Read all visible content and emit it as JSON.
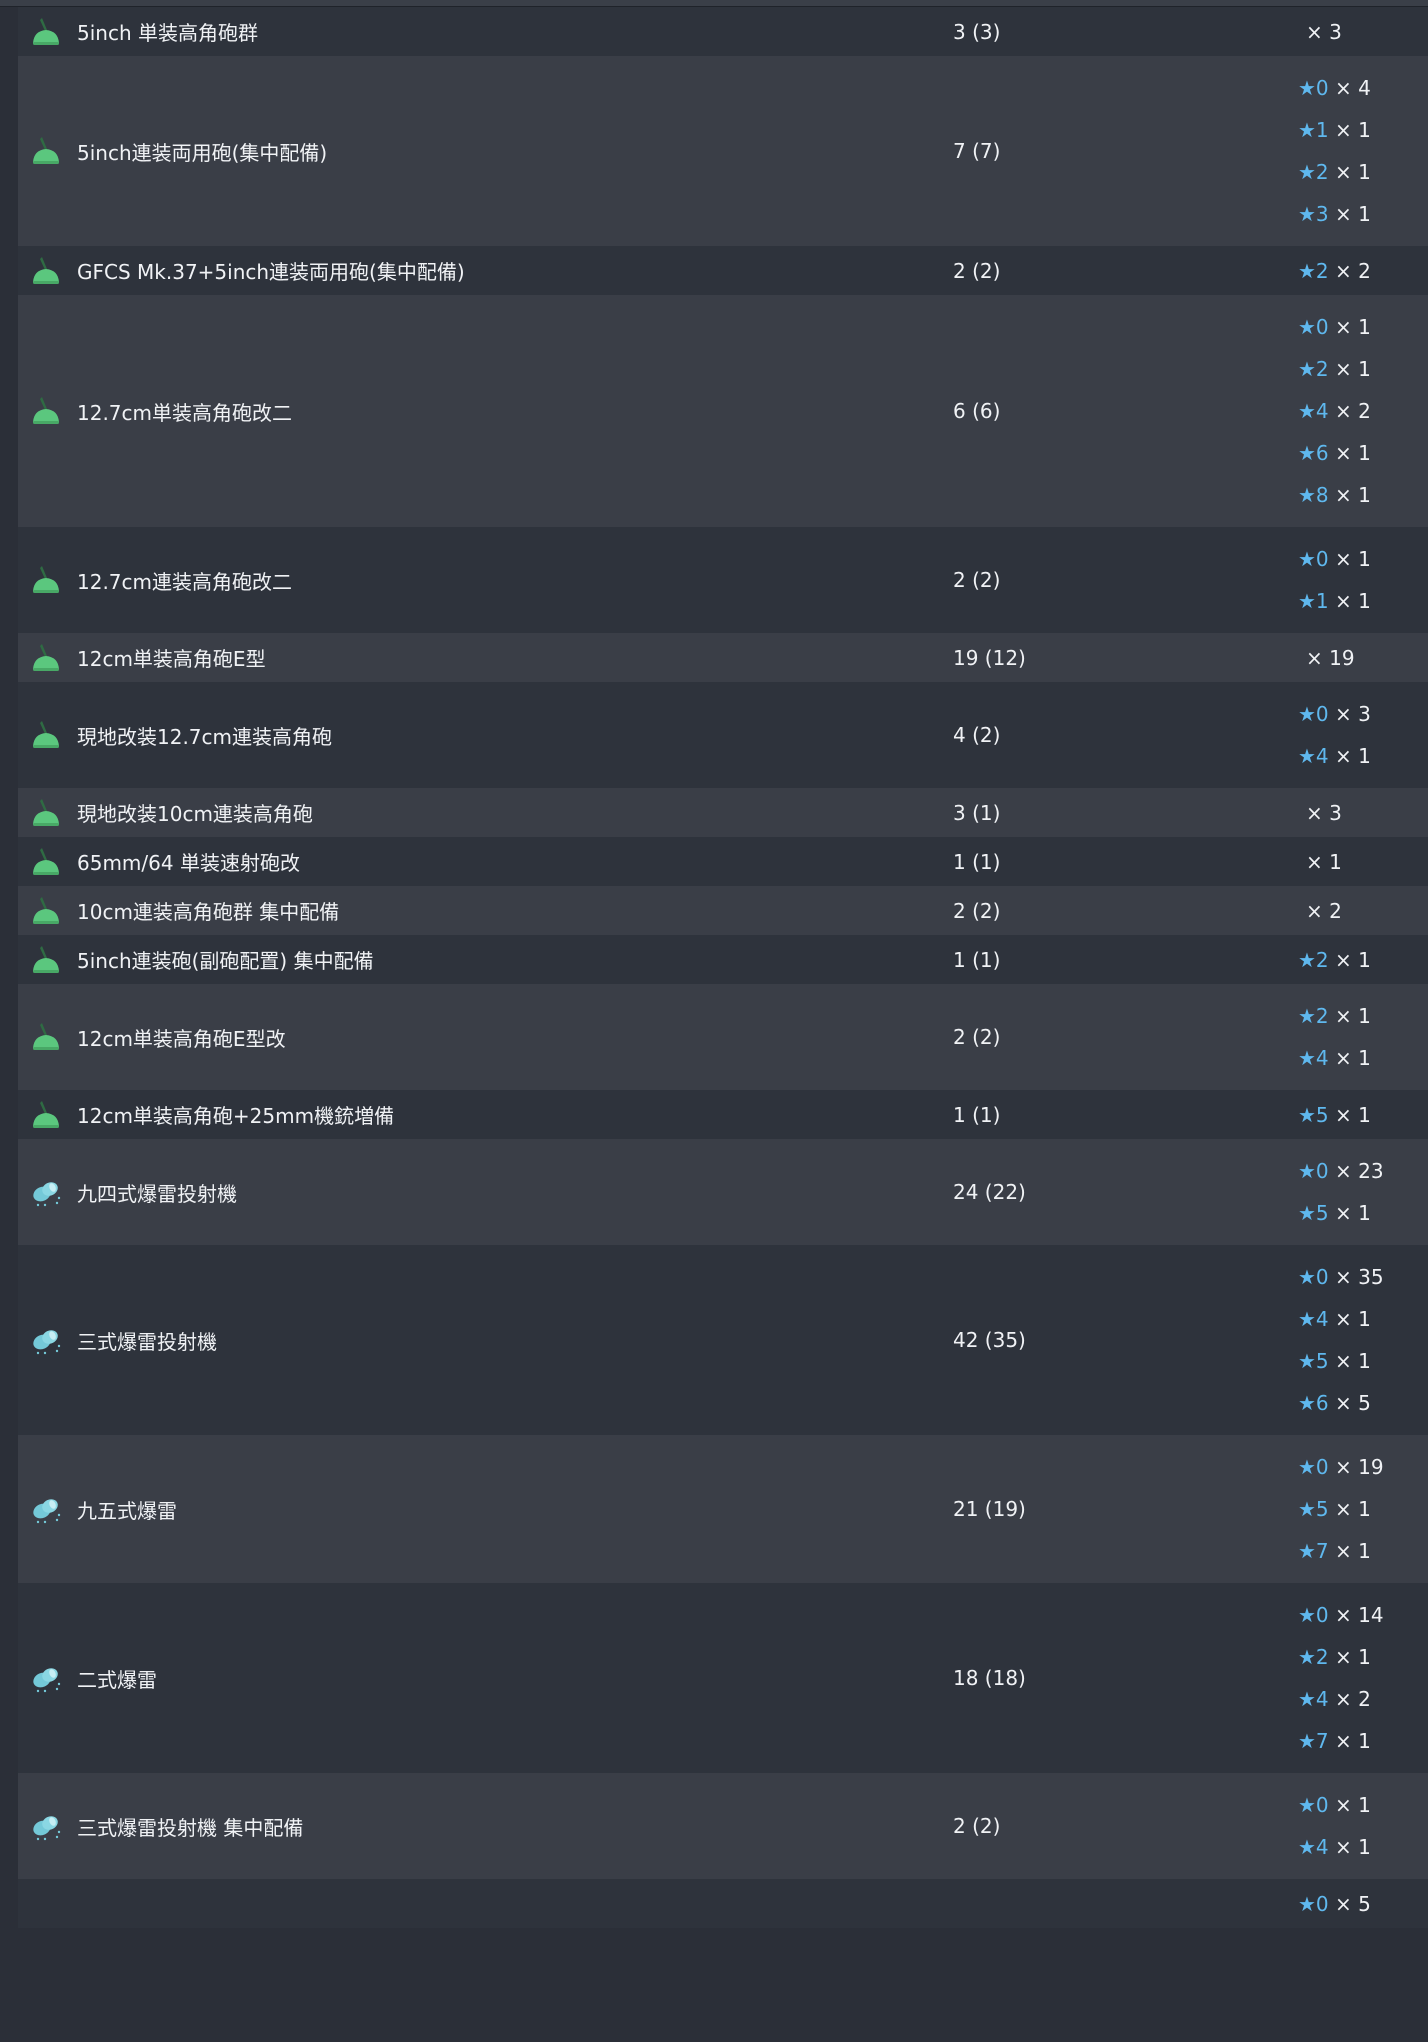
{
  "rows": [
    {
      "icon": "high-angle-gun-icon",
      "name": "5inch 単装高角砲群",
      "count": "3 (3)",
      "stars": [
        {
          "star": null,
          "qty": "× 3"
        }
      ]
    },
    {
      "icon": "high-angle-gun-icon",
      "name": "5inch連装両用砲(集中配備)",
      "count": "7 (7)",
      "stars": [
        {
          "star": "★0",
          "qty": "× 4"
        },
        {
          "star": "★1",
          "qty": "× 1"
        },
        {
          "star": "★2",
          "qty": "× 1"
        },
        {
          "star": "★3",
          "qty": "× 1"
        }
      ]
    },
    {
      "icon": "high-angle-gun-icon",
      "name": "GFCS Mk.37+5inch連装両用砲(集中配備)",
      "count": "2 (2)",
      "stars": [
        {
          "star": "★2",
          "qty": "× 2"
        }
      ]
    },
    {
      "icon": "high-angle-gun-icon",
      "name": "12.7cm単装高角砲改二",
      "count": "6 (6)",
      "stars": [
        {
          "star": "★0",
          "qty": "× 1"
        },
        {
          "star": "★2",
          "qty": "× 1"
        },
        {
          "star": "★4",
          "qty": "× 2"
        },
        {
          "star": "★6",
          "qty": "× 1"
        },
        {
          "star": "★8",
          "qty": "× 1"
        }
      ]
    },
    {
      "icon": "high-angle-gun-icon",
      "name": "12.7cm連装高角砲改二",
      "count": "2 (2)",
      "stars": [
        {
          "star": "★0",
          "qty": "× 1"
        },
        {
          "star": "★1",
          "qty": "× 1"
        }
      ]
    },
    {
      "icon": "high-angle-gun-icon",
      "name": "12cm単装高角砲E型",
      "count": "19 (12)",
      "stars": [
        {
          "star": null,
          "qty": "× 19"
        }
      ]
    },
    {
      "icon": "high-angle-gun-icon",
      "name": "現地改装12.7cm連装高角砲",
      "count": "4 (2)",
      "stars": [
        {
          "star": "★0",
          "qty": "× 3"
        },
        {
          "star": "★4",
          "qty": "× 1"
        }
      ]
    },
    {
      "icon": "high-angle-gun-icon",
      "name": "現地改装10cm連装高角砲",
      "count": "3 (1)",
      "stars": [
        {
          "star": null,
          "qty": "× 3"
        }
      ]
    },
    {
      "icon": "high-angle-gun-icon",
      "name": "65mm/64 単装速射砲改",
      "count": "1 (1)",
      "stars": [
        {
          "star": null,
          "qty": "× 1"
        }
      ]
    },
    {
      "icon": "high-angle-gun-icon",
      "name": "10cm連装高角砲群 集中配備",
      "count": "2 (2)",
      "stars": [
        {
          "star": null,
          "qty": "× 2"
        }
      ]
    },
    {
      "icon": "high-angle-gun-icon",
      "name": "5inch連装砲(副砲配置) 集中配備",
      "count": "1 (1)",
      "stars": [
        {
          "star": "★2",
          "qty": "× 1"
        }
      ]
    },
    {
      "icon": "high-angle-gun-icon",
      "name": "12cm単装高角砲E型改",
      "count": "2 (2)",
      "stars": [
        {
          "star": "★2",
          "qty": "× 1"
        },
        {
          "star": "★4",
          "qty": "× 1"
        }
      ]
    },
    {
      "icon": "high-angle-gun-icon",
      "name": "12cm単装高角砲+25mm機銃増備",
      "count": "1 (1)",
      "stars": [
        {
          "star": "★5",
          "qty": "× 1"
        }
      ]
    },
    {
      "icon": "depth-charge-icon",
      "name": "九四式爆雷投射機",
      "count": "24 (22)",
      "stars": [
        {
          "star": "★0",
          "qty": "× 23"
        },
        {
          "star": "★5",
          "qty": "× 1"
        }
      ]
    },
    {
      "icon": "depth-charge-icon",
      "name": "三式爆雷投射機",
      "count": "42 (35)",
      "stars": [
        {
          "star": "★0",
          "qty": "× 35"
        },
        {
          "star": "★4",
          "qty": "× 1"
        },
        {
          "star": "★5",
          "qty": "× 1"
        },
        {
          "star": "★6",
          "qty": "× 5"
        }
      ]
    },
    {
      "icon": "depth-charge-icon",
      "name": "九五式爆雷",
      "count": "21 (19)",
      "stars": [
        {
          "star": "★0",
          "qty": "× 19"
        },
        {
          "star": "★5",
          "qty": "× 1"
        },
        {
          "star": "★7",
          "qty": "× 1"
        }
      ]
    },
    {
      "icon": "depth-charge-icon",
      "name": "二式爆雷",
      "count": "18 (18)",
      "stars": [
        {
          "star": "★0",
          "qty": "× 14"
        },
        {
          "star": "★2",
          "qty": "× 1"
        },
        {
          "star": "★4",
          "qty": "× 2"
        },
        {
          "star": "★7",
          "qty": "× 1"
        }
      ]
    },
    {
      "icon": "depth-charge-icon",
      "name": "三式爆雷投射機 集中配備",
      "count": "2 (2)",
      "stars": [
        {
          "star": "★0",
          "qty": "× 1"
        },
        {
          "star": "★4",
          "qty": "× 1"
        }
      ]
    },
    {
      "icon": null,
      "name": "",
      "count": "",
      "stars": [
        {
          "star": "★0",
          "qty": "× 5"
        }
      ]
    }
  ],
  "colors": {
    "star": "#5fb8ee",
    "row_odd": "#2e333c",
    "row_even": "#3a3e47",
    "text": "#f0f2f5",
    "gun_icon": "#5bc77e",
    "charge_icon": "#74c9d8"
  }
}
